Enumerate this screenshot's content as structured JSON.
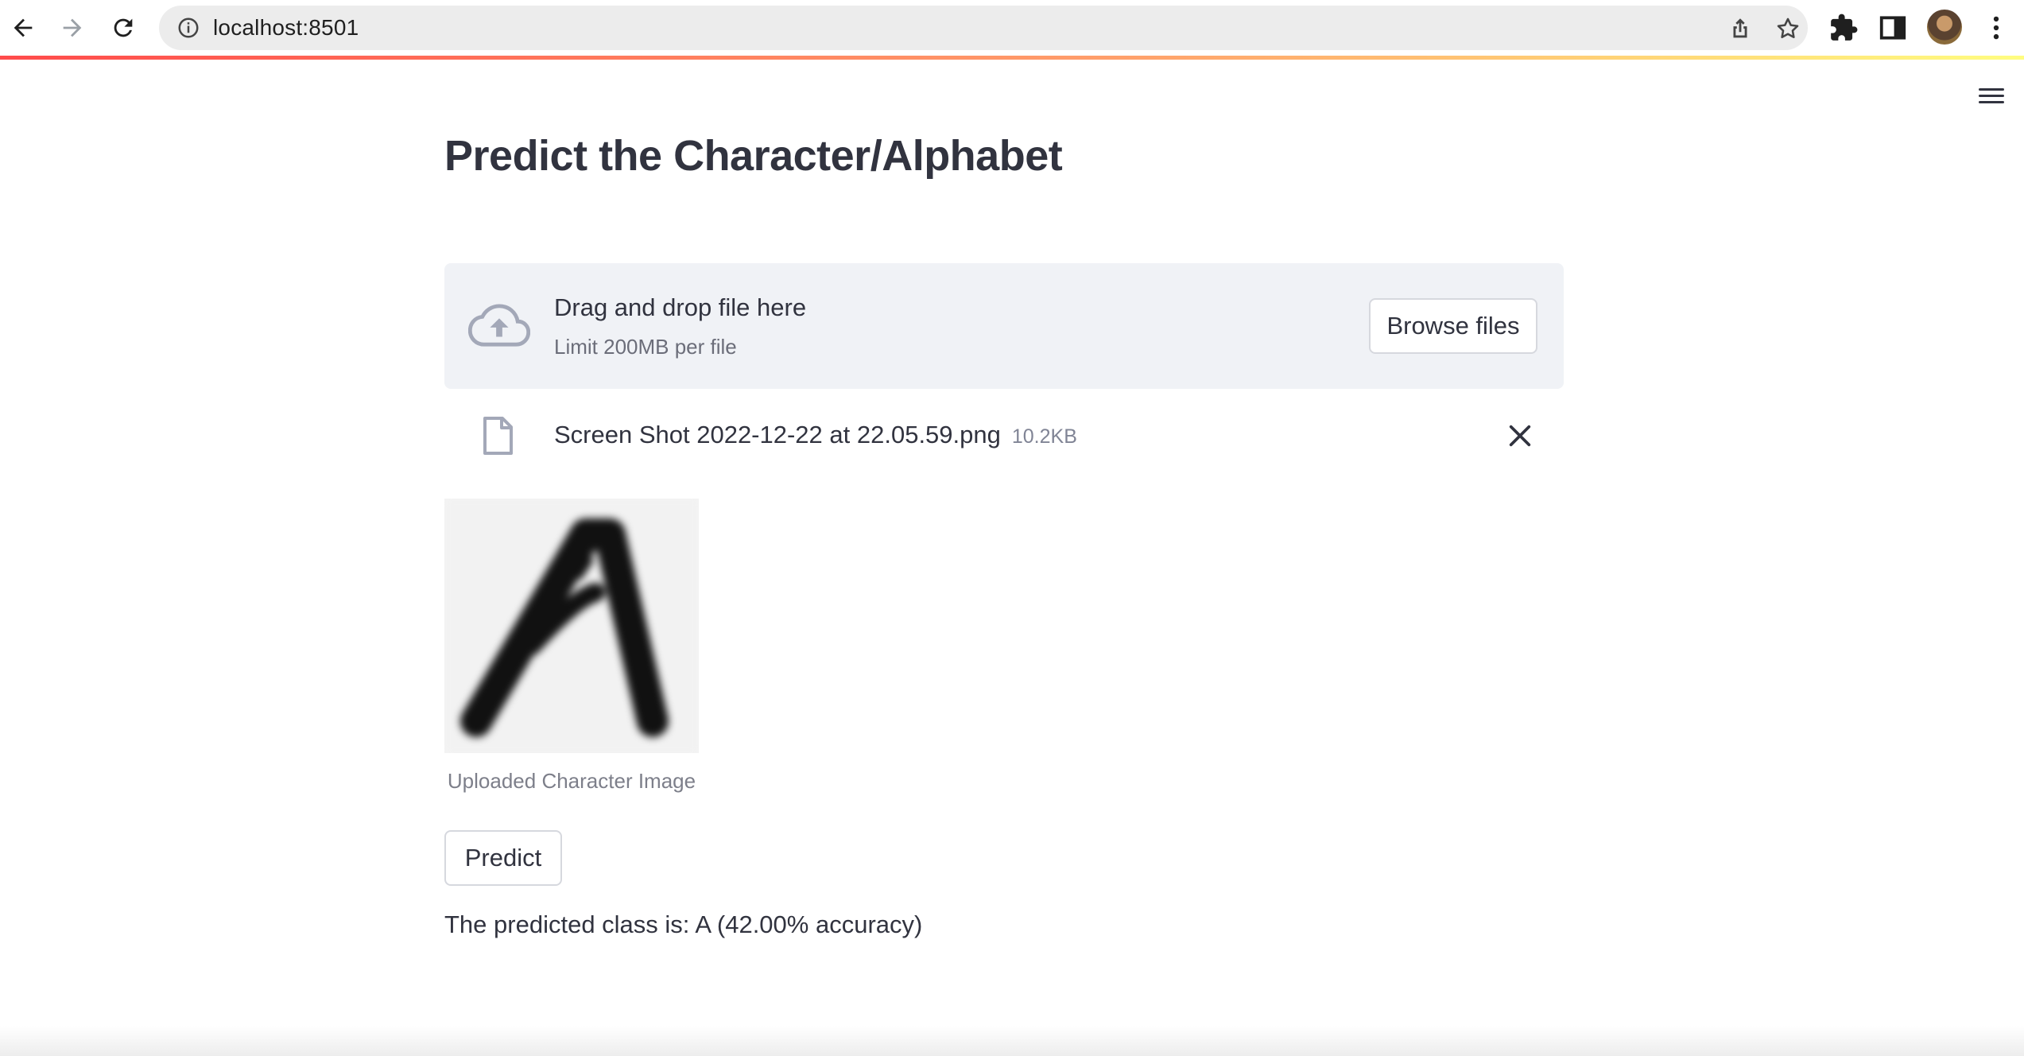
{
  "browser": {
    "url": "localhost:8501",
    "back_icon": "arrow-left-icon",
    "forward_icon": "arrow-right-icon",
    "reload_icon": "reload-icon",
    "site_info_icon": "info-icon",
    "share_icon": "share-icon",
    "bookmark_icon": "star-icon",
    "extensions_icon": "puzzle-icon",
    "side_panel_icon": "side-panel-icon",
    "menu_icon": "kebab-menu-icon"
  },
  "app": {
    "menu_icon": "hamburger-icon",
    "title": "Predict the Character/Alphabet",
    "uploader": {
      "icon": "cloud-upload-icon",
      "drag_text": "Drag and drop file here",
      "limit_text": "Limit 200MB per file",
      "browse_label": "Browse files"
    },
    "uploaded_file": {
      "icon": "file-icon",
      "name": "Screen Shot 2022-12-22 at 22.05.59.png",
      "size": "10.2KB",
      "remove_icon": "close-icon"
    },
    "image": {
      "caption": "Uploaded Character Image"
    },
    "predict_label": "Predict",
    "result_text": "The predicted class is: A (42.00% accuracy)"
  },
  "colors": {
    "accent_gradient_start": "#ff4b4b",
    "accent_gradient_end": "#fffd80",
    "dropzone_bg": "#f0f2f6",
    "text": "#31333f"
  }
}
